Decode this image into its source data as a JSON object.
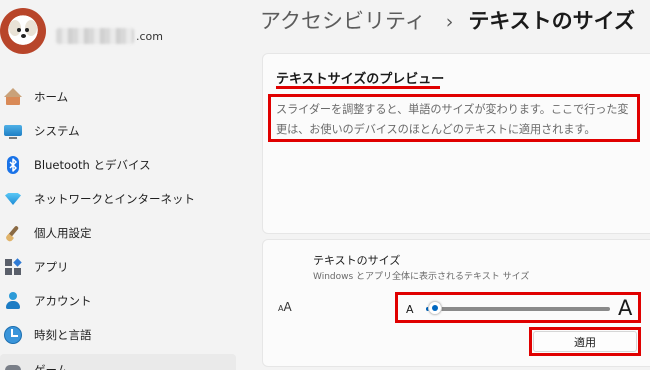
{
  "account": {
    "email_suffix": ".com"
  },
  "sidebar": {
    "items": [
      {
        "label": "ホーム",
        "icon": "home-icon"
      },
      {
        "label": "システム",
        "icon": "system-icon"
      },
      {
        "label": "Bluetooth とデバイス",
        "icon": "bluetooth-icon"
      },
      {
        "label": "ネットワークとインターネット",
        "icon": "network-icon"
      },
      {
        "label": "個人用設定",
        "icon": "personalization-icon"
      },
      {
        "label": "アプリ",
        "icon": "apps-icon"
      },
      {
        "label": "アカウント",
        "icon": "account-icon"
      },
      {
        "label": "時刻と言語",
        "icon": "time-language-icon"
      },
      {
        "label": "ゲーム",
        "icon": "gaming-icon"
      }
    ]
  },
  "header": {
    "breadcrumb_parent": "アクセシビリティ",
    "breadcrumb_separator": "›",
    "breadcrumb_current": "テキストのサイズ"
  },
  "preview": {
    "heading": "テキストサイズのプレビュー",
    "text": "スライダーを調整すると、単語のサイズが変わります。ここで行った変更は、お使いのデバイスのほとんどのテキストに適用されます。"
  },
  "text_size": {
    "title": "テキストのサイズ",
    "subtitle": "Windows とアプリ全体に表示されるテキスト サイズ",
    "icon_small": "A",
    "icon_big": "A",
    "slider_min_label": "A",
    "slider_max_label": "A",
    "slider_value": 0.05,
    "apply_label": "適用"
  },
  "colors": {
    "accent": "#0067c0",
    "highlight": "#e00000",
    "background": "#f3f3f3",
    "card": "#fbfbfb"
  }
}
